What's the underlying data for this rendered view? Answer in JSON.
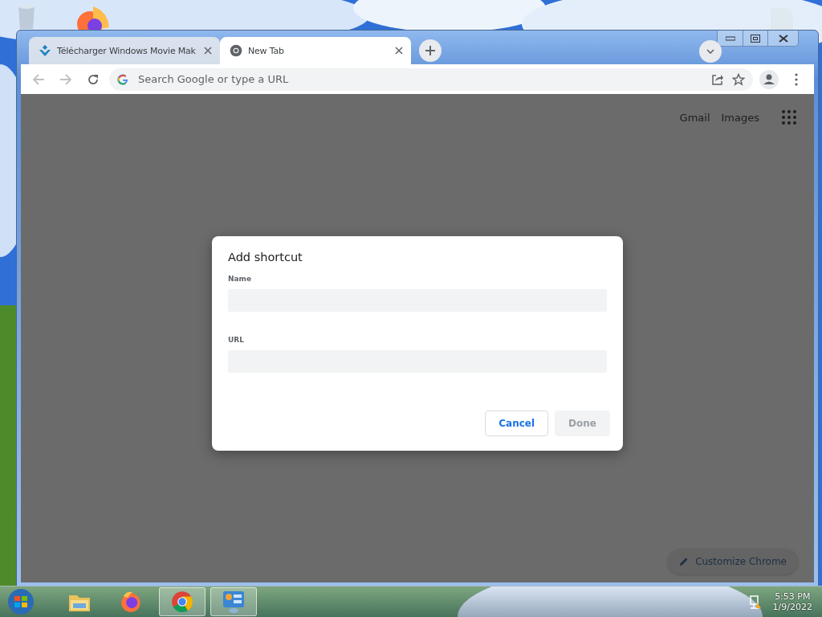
{
  "tabs": [
    {
      "title": "Télécharger Windows Movie Mak",
      "kind": "movie",
      "selected": false
    },
    {
      "title": "New Tab",
      "kind": "chrome",
      "selected": true
    }
  ],
  "omnibox": {
    "placeholder": "Search Google or type a URL"
  },
  "header_links": [
    "Gmail",
    "Images"
  ],
  "dialog": {
    "title": "Add shortcut",
    "fields": [
      {
        "label": "Name"
      },
      {
        "label": "URL"
      }
    ],
    "buttons": [
      {
        "label": "Cancel",
        "disabled": false
      },
      {
        "label": "Done",
        "disabled": true
      }
    ]
  },
  "customize_button": "Customize Chrome",
  "taskbar": {
    "apps": [
      {
        "kind": "explorer",
        "active": false
      },
      {
        "kind": "firefox",
        "active": false
      },
      {
        "kind": "chrome",
        "active": true
      },
      {
        "kind": "control-panel",
        "active": true
      }
    ],
    "time": "5:53 PM",
    "date": "1/9/2022"
  }
}
